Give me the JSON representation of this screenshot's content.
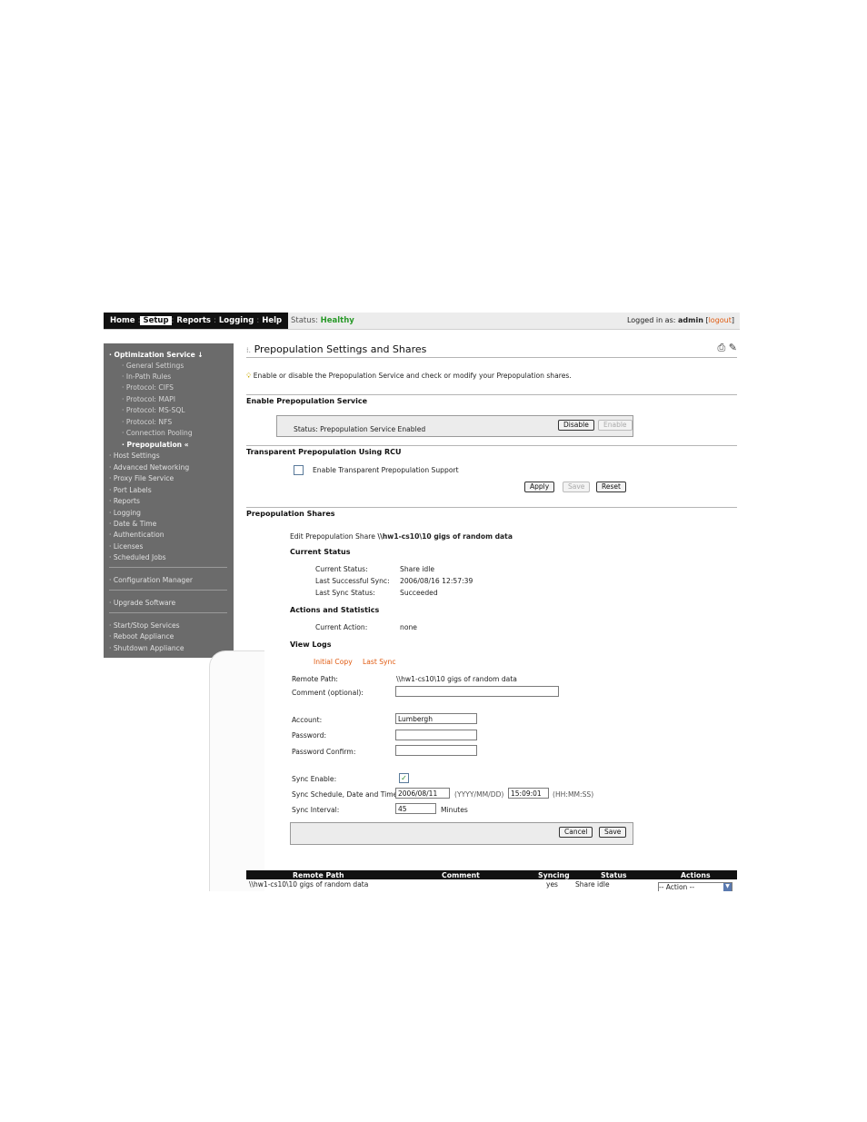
{
  "nav": {
    "tabs": [
      "Home",
      "Setup",
      "Reports",
      "Logging",
      "Help"
    ],
    "active": "Setup"
  },
  "status": {
    "label": "Status:",
    "value": "Healthy"
  },
  "login": {
    "text": "Logged in as:",
    "user": "admin",
    "logout": "logout"
  },
  "sidebar": {
    "section": "Optimization Service ↓",
    "sub_items": [
      "General Settings",
      "In-Path Rules",
      "Protocol: CIFS",
      "Protocol: MAPI",
      "Protocol: MS-SQL",
      "Protocol: NFS",
      "Connection Pooling"
    ],
    "current": "Prepopulation «",
    "items": [
      "Host Settings",
      "Advanced Networking",
      "Proxy File Service",
      "Port Labels",
      "Reports",
      "Logging",
      "Date & Time",
      "Authentication",
      "Licenses",
      "Scheduled Jobs"
    ],
    "group2": [
      "Configuration Manager"
    ],
    "group3": [
      "Upgrade Software"
    ],
    "group4": [
      "Start/Stop Services",
      "Reboot Appliance",
      "Shutdown Appliance"
    ]
  },
  "page": {
    "title": "Prepopulation Settings and Shares",
    "hint": "Enable or disable the Prepopulation Service and check or modify your Prepopulation shares."
  },
  "enable_section": {
    "title": "Enable Prepopulation Service",
    "status": "Status: Prepopulation Service Enabled",
    "disable_label": "Disable",
    "enable_label": "Enable"
  },
  "rcu_section": {
    "title": "Transparent Prepopulation Using RCU",
    "checkbox_label": "Enable Transparent Prepopulation Support",
    "apply": "Apply",
    "save": "Save",
    "reset": "Reset"
  },
  "shares": {
    "title": "Prepopulation Shares",
    "edit_prefix": "Edit Prepopulation Share",
    "edit_share": "\\\\hw1-cs10\\10 gigs of random data",
    "current_status_title": "Current Status",
    "current_status_label": "Current Status:",
    "current_status_value": "Share idle",
    "last_sync_label": "Last Successful Sync:",
    "last_sync_value": "2006/08/16 12:57:39",
    "last_sync_status_label": "Last Sync Status:",
    "last_sync_status_value": "Succeeded",
    "actions_title": "Actions and Statistics",
    "current_action_label": "Current Action:",
    "current_action_value": "none",
    "view_logs_title": "View Logs",
    "log_initial": "Initial Copy",
    "log_last": "Last Sync",
    "remote_path_label": "Remote Path:",
    "remote_path_value": "\\\\hw1-cs10\\10 gigs of random data",
    "comment_label": "Comment (optional):",
    "comment_value": "",
    "account_label": "Account:",
    "account_value": "Lumbergh",
    "password_label": "Password:",
    "password_confirm_label": "Password Confirm:",
    "sync_enable_label": "Sync Enable:",
    "sync_enabled": true,
    "schedule_label": "Sync Schedule, Date and Time:",
    "schedule_date": "2006/08/11",
    "date_fmt": "(YYYY/MM/DD)",
    "schedule_time": "15:09:01",
    "time_fmt": "(HH:MM:SS)",
    "interval_label": "Sync Interval:",
    "interval_value": "45",
    "interval_unit": "Minutes",
    "cancel": "Cancel",
    "save": "Save"
  },
  "table": {
    "headers": [
      "Remote Path",
      "Comment",
      "Syncing",
      "Status",
      "Actions"
    ],
    "row": {
      "path": "\\\\hw1-cs10\\10 gigs of random data",
      "syncing": "yes",
      "status": "Share idle",
      "action": "-- Action --"
    }
  }
}
